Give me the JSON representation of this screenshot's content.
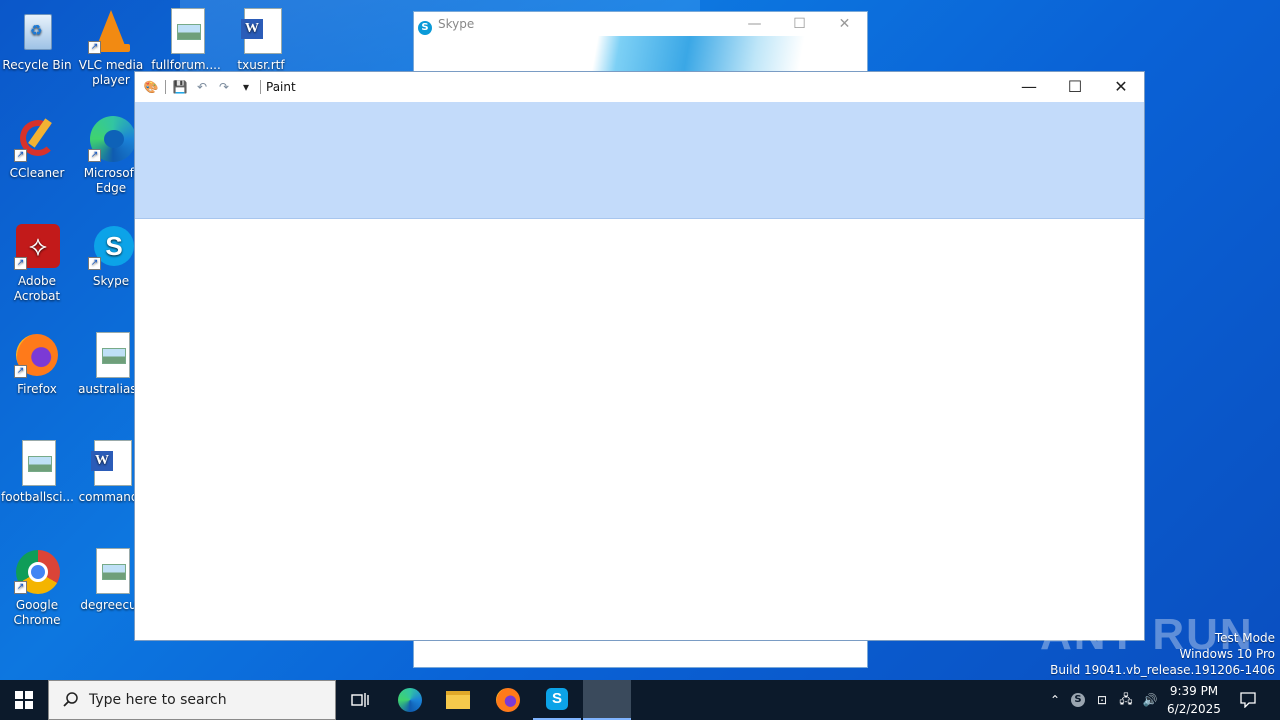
{
  "desktop": {
    "icons": [
      {
        "label": "Recycle Bin"
      },
      {
        "label": "VLC media player"
      },
      {
        "label": "fullforum...."
      },
      {
        "label": "txusr.rtf"
      },
      {
        "label": "CCleaner"
      },
      {
        "label": "Microsoft Edge"
      },
      {
        "label": "Adobe Acrobat"
      },
      {
        "label": "Skype"
      },
      {
        "label": "Firefox"
      },
      {
        "label": "australiasa"
      },
      {
        "label": "footballsci..."
      },
      {
        "label": "commandr"
      },
      {
        "label": "Google Chrome"
      },
      {
        "label": "degreecur"
      }
    ]
  },
  "skype_window": {
    "title": "Skype",
    "minimize": "—",
    "maximize": "☐",
    "close": "✕"
  },
  "paint_window": {
    "title": "Paint",
    "minimize": "—",
    "maximize": "☐",
    "close": "✕"
  },
  "watermark": {
    "text": "ANY RUN"
  },
  "system_info": {
    "line1": "Test Mode",
    "line2": "Windows 10 Pro",
    "line3": "Build 19041.vb_release.191206-1406"
  },
  "taskbar": {
    "search_placeholder": "Type here to search",
    "clock_time": "9:39 PM",
    "clock_date": "6/2/2025"
  }
}
